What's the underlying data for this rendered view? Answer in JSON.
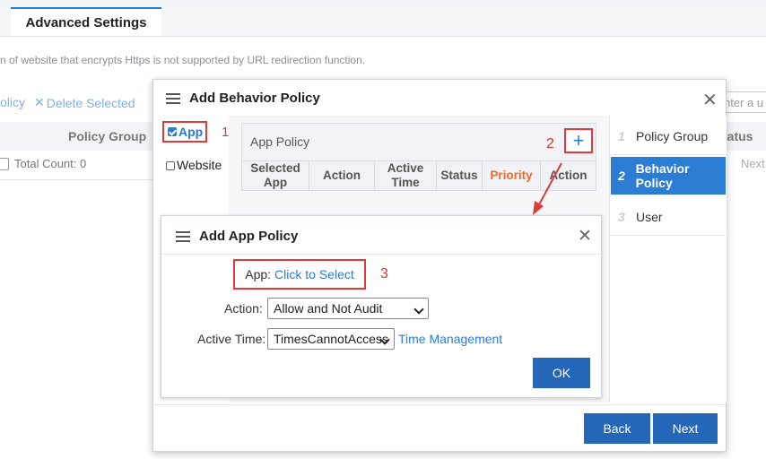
{
  "background": {
    "tab_label": "Advanced Settings",
    "notice": "n of website that encrypts Https is not supported by URL redirection function.",
    "toolbar_policy": "olicy",
    "toolbar_delete": "Delete Selected",
    "search_placeholder": "nter a u",
    "col_policy_group": "Policy Group",
    "col_status": "tatus",
    "total_count": "Total Count: 0",
    "next_link": "Next"
  },
  "dialog": {
    "title": "Add Behavior Policy",
    "types": {
      "app": "App",
      "website": "Website"
    },
    "app_policy_label": "App Policy",
    "table_headers": [
      "Selected App",
      "Action",
      "Active Time",
      "Status",
      "Priority",
      "Action"
    ],
    "nav": [
      {
        "num": "1",
        "label": "Policy Group"
      },
      {
        "num": "2",
        "label": "Behavior Policy"
      },
      {
        "num": "3",
        "label": "User"
      }
    ],
    "back_label": "Back",
    "next_label": "Next"
  },
  "sub_dialog": {
    "title": "Add App Policy",
    "app_label": "App:",
    "app_link": "Click to Select",
    "action_label": "Action:",
    "action_value": "Allow and Not Audit",
    "time_label": "Active Time:",
    "time_value": "TimesCannotAccess",
    "time_mgmt_link": "Time Management",
    "ok_label": "OK"
  },
  "annotations": {
    "n1": "1",
    "n2": "2",
    "n3": "3"
  },
  "colors": {
    "accent": "#2b7cd3",
    "button": "#2467b8",
    "annotation_red": "#e03a3a",
    "priority": "#f06a2a"
  },
  "icons": {
    "menu": "hamburger-icon",
    "close": "close-icon",
    "add": "plus-icon",
    "delete": "x-icon"
  }
}
